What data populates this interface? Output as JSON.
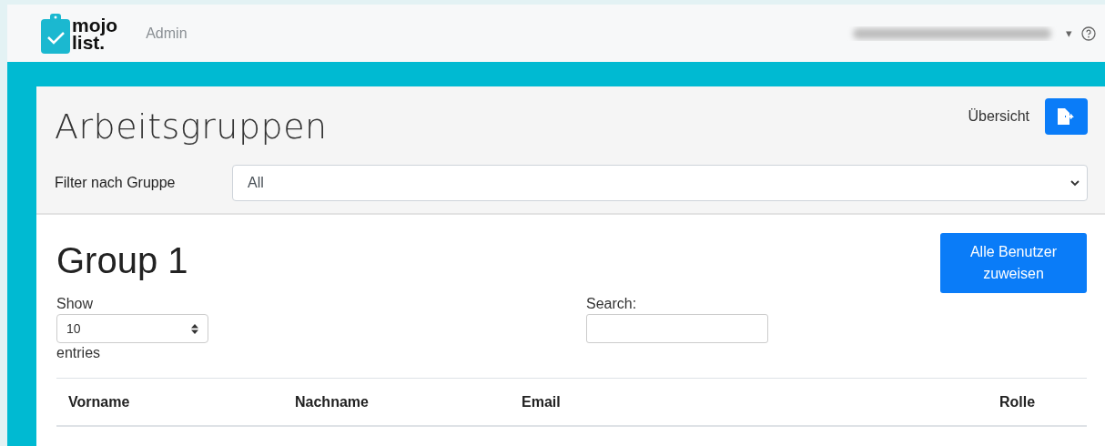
{
  "header": {
    "logo": {
      "line_1": "mojo",
      "line_2": "list."
    },
    "nav": [
      {
        "label": "Admin"
      }
    ],
    "user_menu_caret": "▾"
  },
  "page": {
    "title": "Arbeitsgruppen",
    "overview_link": "Übersicht",
    "filter": {
      "label": "Filter nach Gruppe",
      "value": "All"
    }
  },
  "group": {
    "title": "Group 1",
    "assign_button": "Alle Benutzer zuweisen",
    "length": {
      "before": "Show",
      "value": "10",
      "after": "entries"
    },
    "search": {
      "label": "Search:"
    },
    "table": {
      "columns": [
        "Vorname",
        "Nachname",
        "Email",
        "Rolle"
      ]
    }
  }
}
